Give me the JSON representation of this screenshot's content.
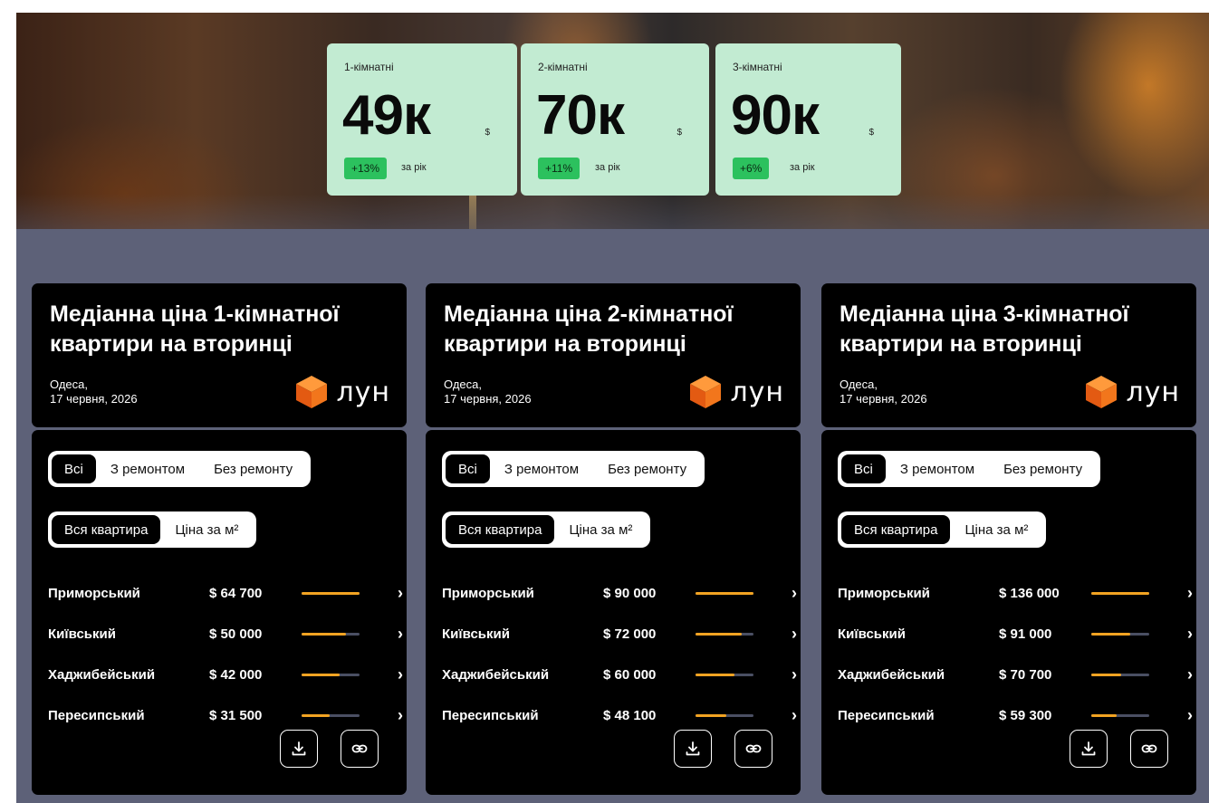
{
  "stats": [
    {
      "label": "1-кімнатні",
      "value": "49к",
      "currency": "$",
      "change": "+13%",
      "period": "за рік"
    },
    {
      "label": "2-кімнатні",
      "value": "70к",
      "currency": "$",
      "change": "+11%",
      "period": "за рік"
    },
    {
      "label": "3-кімнатні",
      "value": "90к",
      "currency": "$",
      "change": "+6%",
      "period": "за рік"
    }
  ],
  "brand": {
    "logo_text": "лун",
    "logo_color": "#f26b1d"
  },
  "colors": {
    "accent_bar": "#f2a322",
    "change_badge": "#2cc15e",
    "stat_card": "#c2ebd2"
  },
  "cards": [
    {
      "title": "Медіанна ціна 1-кімнатної квартири на вторинці",
      "city": "Одеса,",
      "date": "17 червня, 2026",
      "filters_condition": [
        "Всі",
        "З ремонтом",
        "Без ремонту"
      ],
      "filters_unit": [
        "Вся квартира",
        "Ціна за м²"
      ],
      "rows": [
        {
          "district": "Приморський",
          "price": "$ 64 700",
          "level": 1.0
        },
        {
          "district": "Київський",
          "price": "$ 50 000",
          "level": 0.77
        },
        {
          "district": "Хаджибейський",
          "price": "$ 42 000",
          "level": 0.65
        },
        {
          "district": "Пересипський",
          "price": "$ 31 500",
          "level": 0.49
        }
      ]
    },
    {
      "title": "Медіанна ціна 2-кімнатної квартири на вторинці",
      "city": "Одеса,",
      "date": "17 червня, 2026",
      "filters_condition": [
        "Всі",
        "З ремонтом",
        "Без ремонту"
      ],
      "filters_unit": [
        "Вся квартира",
        "Ціна за м²"
      ],
      "rows": [
        {
          "district": "Приморський",
          "price": "$ 90 000",
          "level": 1.0
        },
        {
          "district": "Київський",
          "price": "$ 72 000",
          "level": 0.8
        },
        {
          "district": "Хаджибейський",
          "price": "$ 60 000",
          "level": 0.67
        },
        {
          "district": "Пересипський",
          "price": "$ 48 100",
          "level": 0.53
        }
      ]
    },
    {
      "title": "Медіанна ціна 3-кімнатної квартири на вторинці",
      "city": "Одеса,",
      "date": "17 червня, 2026",
      "filters_condition": [
        "Всі",
        "З ремонтом",
        "Без ремонту"
      ],
      "filters_unit": [
        "Вся квартира",
        "Ціна за м²"
      ],
      "rows": [
        {
          "district": "Приморський",
          "price": "$ 136 000",
          "level": 1.0
        },
        {
          "district": "Київський",
          "price": "$ 91 000",
          "level": 0.67
        },
        {
          "district": "Хаджибейський",
          "price": "$ 70 700",
          "level": 0.52
        },
        {
          "district": "Пересипський",
          "price": "$ 59 300",
          "level": 0.44
        }
      ]
    }
  ],
  "actions": {
    "download_icon": "download-icon",
    "link_icon": "link-icon"
  }
}
